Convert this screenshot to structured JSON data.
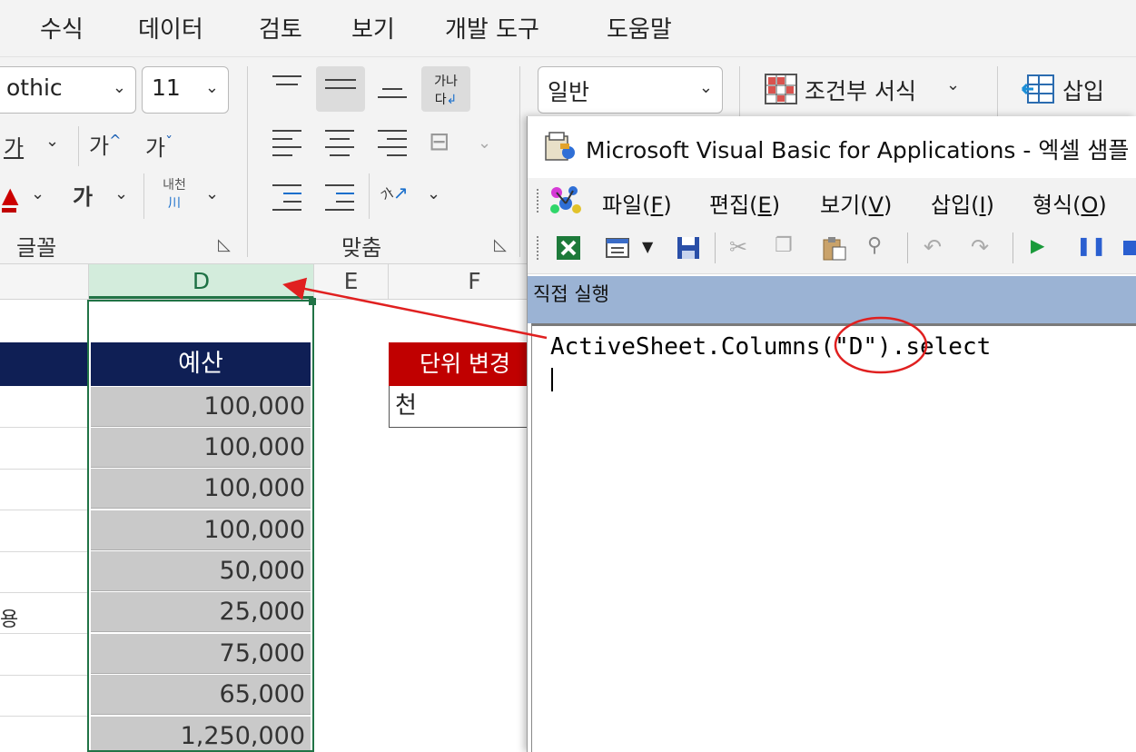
{
  "ribbon_tabs": [
    "수식",
    "데이터",
    "검토",
    "보기",
    "개발 도구",
    "도움말"
  ],
  "font": {
    "name_value": "othic",
    "size_value": "11",
    "grow_label": "가",
    "shrink_label": "가",
    "underline_label": "가",
    "bold_label": "가",
    "phonetic_label": "내천",
    "phonetic_sub": "川",
    "group_label": "글꼴"
  },
  "alignment": {
    "wrap_label_top": "가나",
    "wrap_label_bottom": "다",
    "orient_label": "가",
    "group_label": "맞춤"
  },
  "number": {
    "format_value": "일반"
  },
  "styles": {
    "conditional_format_label": "조건부 서식"
  },
  "cells": {
    "insert_label": "삽입"
  },
  "columns": [
    "D",
    "E",
    "F"
  ],
  "selected_column": "D",
  "sheet": {
    "budget_header": "예산",
    "budget_values": [
      "100,000",
      "100,000",
      "100,000",
      "100,000",
      "50,000",
      "25,000",
      "75,000",
      "65,000",
      "1,250,000"
    ],
    "partial_row_text": "용",
    "unit_header": "단위 변경",
    "unit_value": "천"
  },
  "vba": {
    "title": "Microsoft Visual Basic for Applications - 엑셀 샘플",
    "menu": [
      {
        "label": "파일(",
        "key": "F",
        "end": ")"
      },
      {
        "label": "편집(",
        "key": "E",
        "end": ")"
      },
      {
        "label": "보기(",
        "key": "V",
        "end": ")"
      },
      {
        "label": "삽입(",
        "key": "I",
        "end": ")"
      },
      {
        "label": "형식(",
        "key": "O",
        "end": ")"
      }
    ],
    "immediate_title": "직접 실행",
    "code_line": "ActiveSheet.Columns(\"D\").select"
  },
  "colors": {
    "selection_green": "#217346",
    "header_navy": "#0f1f55",
    "unit_red": "#c00000",
    "annotation_red": "#e02020",
    "immediate_bar": "#9bb3d4"
  }
}
